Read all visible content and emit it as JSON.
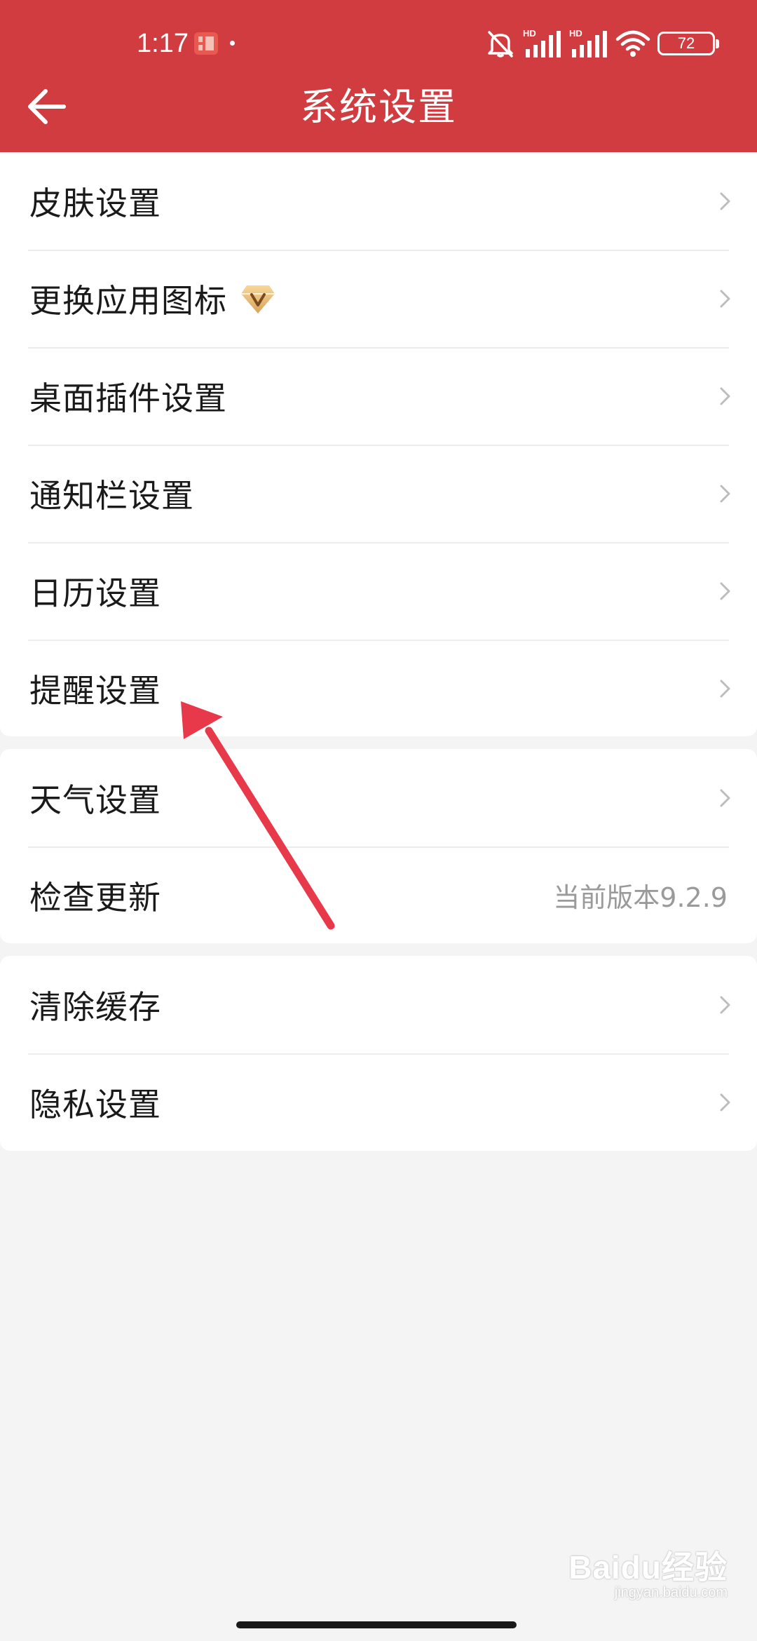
{
  "status_bar": {
    "time": "1:17",
    "battery": "72",
    "network_label_1": "HD",
    "network_label_2": "HD"
  },
  "header": {
    "title": "系统设置",
    "back_icon": "arrow-left-icon"
  },
  "groups": [
    {
      "items": [
        {
          "label": "皮肤设置"
        },
        {
          "label": "更换应用图标",
          "badge_icon": "vip-diamond-icon"
        },
        {
          "label": "桌面插件设置"
        },
        {
          "label": "通知栏设置"
        },
        {
          "label": "日历设置"
        },
        {
          "label": "提醒设置"
        }
      ]
    },
    {
      "items": [
        {
          "label": "天气设置"
        },
        {
          "label": "检查更新",
          "value": "当前版本9.2.9"
        }
      ]
    },
    {
      "items": [
        {
          "label": "清除缓存"
        },
        {
          "label": "隐私设置"
        }
      ]
    }
  ],
  "annotation": {
    "color": "#e8394a",
    "icon": "annotation-arrow-icon"
  },
  "watermark": {
    "logo": "Baidu经验",
    "url": "jingyan.baidu.com"
  },
  "colors": {
    "header_bg": "#d03c3f",
    "page_bg": "#f4f4f4",
    "text": "#1a1a1a",
    "secondary_text": "#9a9a9a"
  }
}
